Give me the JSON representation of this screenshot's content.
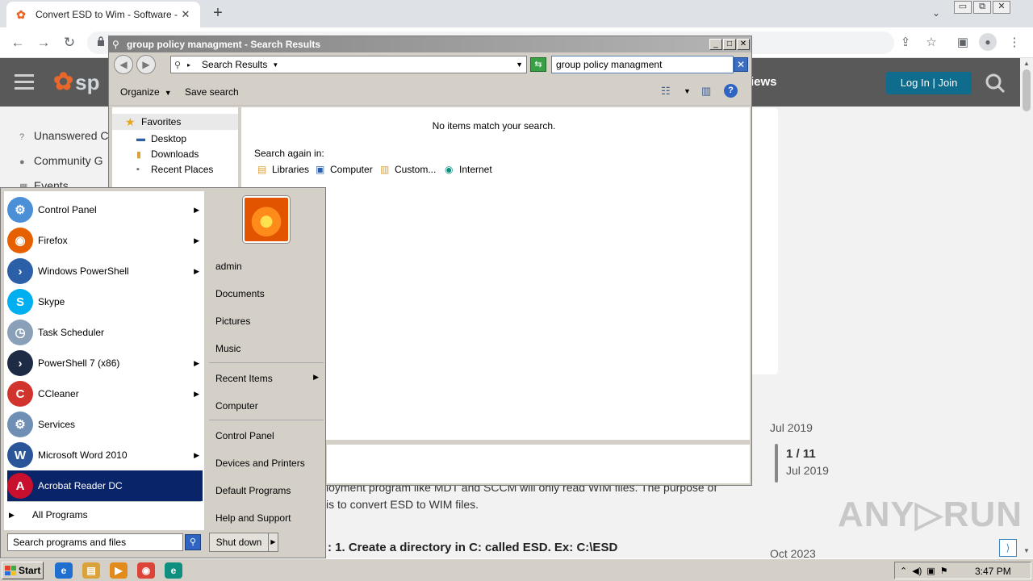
{
  "browser": {
    "tab_title": "Convert ESD to Wim - Software - Sp",
    "tab_close": "✕",
    "new_tab": "+",
    "tab_search": "⌄",
    "window_buttons": [
      "▭",
      "⧉",
      "✕"
    ],
    "nav": {
      "back": "←",
      "forward": "→",
      "reload": "↻"
    },
    "toolbar_icons": {
      "share": "⇪",
      "bookmark": "☆",
      "sidebar": "▣",
      "profile": "●",
      "menu": "⋮"
    }
  },
  "site": {
    "logo_letters": "sp",
    "nav_partial": "iews",
    "login_label": "Log In | Join",
    "sidebar": [
      {
        "label": "Unanswered C",
        "icon": "?"
      },
      {
        "label": "Community G",
        "icon": "●"
      },
      {
        "label": "Events",
        "icon": "▦"
      }
    ],
    "article_lines": [
      "loyment program like MDT and SCCM will only read WIM files. The purpose of",
      "is to convert ESD to WIM files."
    ],
    "article_step": ": 1. Create a directory in C: called ESD. Ex: C:\\ESD",
    "timeline": {
      "date_top": "Jul 2019",
      "count": "1 / 11",
      "count_date": "Jul 2019",
      "date_bottom": "Oct 2023"
    },
    "watermark": "ANY▷RUN",
    "scroll_top": "⟩"
  },
  "explorer": {
    "title": "group policy managment - Search Results",
    "title_buttons": [
      "_",
      "□",
      "✕"
    ],
    "breadcrumb": "Search Results",
    "search_value": "group policy managment",
    "search_clear": "✕",
    "refresh": "⇆",
    "commands": {
      "organize": "Organize",
      "save_search": "Save search"
    },
    "help": "?",
    "favorites_label": "Favorites",
    "favorites": [
      {
        "label": "Desktop",
        "icon": "▬"
      },
      {
        "label": "Downloads",
        "icon": "▮"
      },
      {
        "label": "Recent Places",
        "icon": "▪"
      }
    ],
    "no_items": "No items match your search.",
    "search_again_label": "Search again in:",
    "search_again": [
      {
        "label": "Libraries",
        "icon": "▤"
      },
      {
        "label": "Computer",
        "icon": "▣"
      },
      {
        "label": "Custom...",
        "icon": "▥"
      },
      {
        "label": "Internet",
        "icon": "◉"
      }
    ]
  },
  "start_menu": {
    "programs": [
      {
        "label": "Control Panel",
        "icon": "⚙",
        "color": "#4b8fd6",
        "arrow": true
      },
      {
        "label": "Firefox",
        "icon": "◉",
        "color": "#e66000",
        "arrow": true
      },
      {
        "label": "Windows PowerShell",
        "icon": "›",
        "color": "#2b5fa8",
        "arrow": true
      },
      {
        "label": "Skype",
        "icon": "S",
        "color": "#00aff0",
        "arrow": false
      },
      {
        "label": "Task Scheduler",
        "icon": "◷",
        "color": "#8aa0b8",
        "arrow": false
      },
      {
        "label": "PowerShell 7 (x86)",
        "icon": "›",
        "color": "#1d2b45",
        "arrow": true
      },
      {
        "label": "CCleaner",
        "icon": "C",
        "color": "#d0342c",
        "arrow": true
      },
      {
        "label": "Services",
        "icon": "⚙",
        "color": "#6f8fb5",
        "arrow": false
      },
      {
        "label": "Microsoft Word 2010",
        "icon": "W",
        "color": "#2a5699",
        "arrow": true
      },
      {
        "label": "Acrobat Reader DC",
        "icon": "A",
        "color": "#c8102e",
        "arrow": false
      }
    ],
    "all_programs": "All Programs",
    "all_programs_arrow": "▶",
    "search_placeholder": "Search programs and files",
    "search_icon": "⚲",
    "right_links_1": [
      "admin",
      "Documents",
      "Pictures",
      "Music"
    ],
    "recent_items": "Recent Items",
    "right_links_2": [
      "Computer"
    ],
    "right_links_3": [
      "Control Panel",
      "Devices and Printers",
      "Default Programs",
      "Help and Support"
    ],
    "shutdown_label": "Shut down",
    "shutdown_arrow": "▶"
  },
  "taskbar": {
    "start_label": "Start",
    "quick_launch": [
      {
        "icon": "e",
        "color": "#1f6fd1"
      },
      {
        "icon": "▤",
        "color": "#d9a23a"
      },
      {
        "icon": "▶",
        "color": "#e28b1a"
      },
      {
        "icon": "◉",
        "color": "#db4437"
      },
      {
        "icon": "e",
        "color": "#0f8f7e"
      }
    ],
    "tray_icons": [
      "⌃",
      "◀)",
      "▣",
      "⚑"
    ],
    "clock": "3:47 PM"
  }
}
